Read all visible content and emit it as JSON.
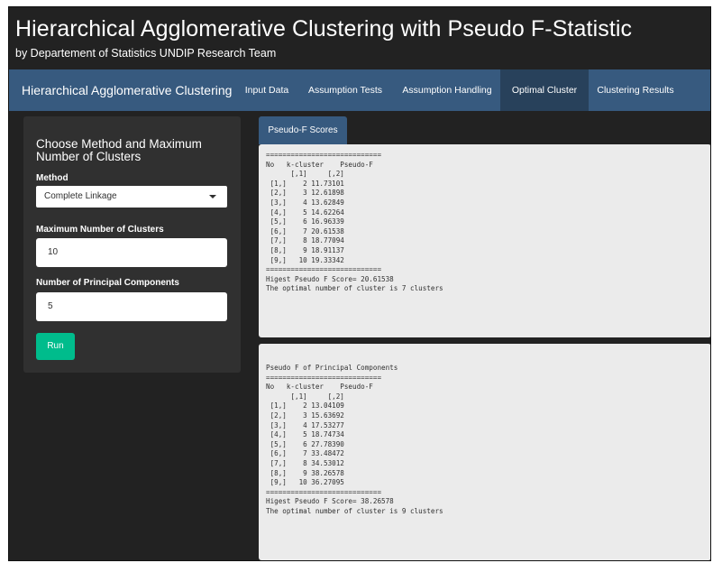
{
  "header": {
    "title": "Hierarchical Agglomerative Clustering with Pseudo F-Statistic",
    "subtitle": "by Departement of Statistics UNDIP Research Team"
  },
  "navbar": {
    "brand": "Hierarchical Agglomerative Clustering",
    "tabs": [
      "Input Data",
      "Assumption Tests",
      "Assumption Handling",
      "Optimal Cluster",
      "Clustering Results"
    ],
    "active_tab": "Optimal Cluster"
  },
  "sidebar": {
    "heading": "Choose Method and Maximum Number of Clusters",
    "method_label": "Method",
    "method_value": "Complete Linkage",
    "max_clusters_label": "Maximum Number of Clusters",
    "max_clusters_value": "10",
    "pc_label": "Number of Principal Components",
    "pc_value": "5",
    "run_label": "Run"
  },
  "tab": {
    "label": "Pseudo-F Scores"
  },
  "output1": {
    "text": "============================\nNo   k-cluster    Pseudo-F\n      [,1]     [,2]\n [1,]    2 11.73101\n [2,]    3 12.61898\n [3,]    4 13.62849\n [4,]    5 14.62264\n [5,]    6 16.96339\n [6,]    7 20.61538\n [7,]    8 18.77094\n [8,]    9 18.91137\n [9,]   10 19.33342\n============================\nHigest Pseudo F Score= 20.61538\nThe optimal number of cluster is 7 clusters"
  },
  "output2": {
    "text": "Pseudo F of Principal Components\n============================\nNo   k-cluster    Pseudo-F\n      [,1]     [,2]\n [1,]    2 13.04109\n [2,]    3 15.63692\n [3,]    4 17.53277\n [4,]    5 18.74734\n [5,]    6 27.78390\n [6,]    7 33.48472\n [7,]    8 34.53012\n [8,]    9 38.26578\n [9,]   10 36.27095\n============================\nHigest Pseudo F Score= 38.26578\nThe optimal number of cluster is 9 clusters"
  }
}
